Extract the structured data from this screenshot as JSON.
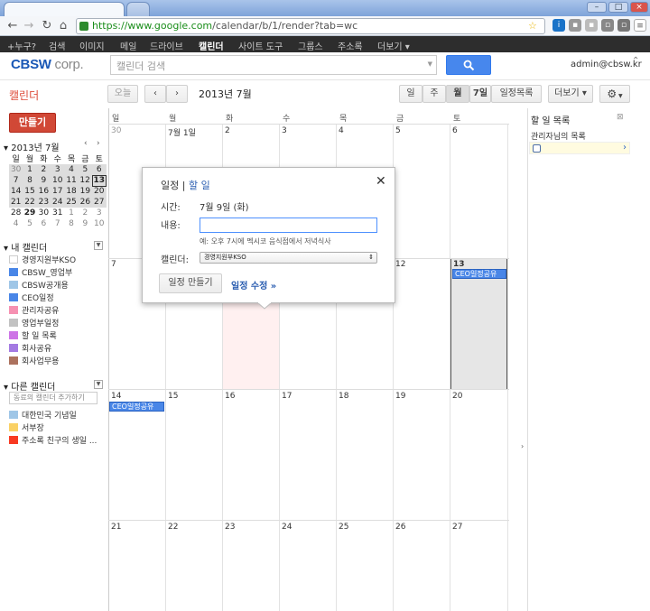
{
  "browser": {
    "url_host": "https://www.google.com",
    "url_path": "/calendar/b/1/render?tab=wc"
  },
  "gbar": {
    "items": [
      "+누구?",
      "검색",
      "이미지",
      "메일",
      "드라이브",
      "캘린더",
      "사이트 도구",
      "그룹스",
      "주소록",
      "더보기 ▾"
    ]
  },
  "header": {
    "logo": "CBSW corp.",
    "search_placeholder": "캘린더 검색",
    "user": "admin@cbsw.kr"
  },
  "toolbar": {
    "title": "캘린더",
    "today": "오늘",
    "date_range": "2013년 7월",
    "views": [
      "일",
      "주",
      "월",
      "7일",
      "일정목록"
    ],
    "more": "더보기 ▾"
  },
  "sidebar": {
    "create": "만들기",
    "mini_title": "2013년 7월",
    "mini_weekdays": [
      "일",
      "월",
      "화",
      "수",
      "목",
      "금",
      "토"
    ],
    "mini_weeks": [
      [
        "30",
        "1",
        "2",
        "3",
        "4",
        "5",
        "6"
      ],
      [
        "7",
        "8",
        "9",
        "10",
        "11",
        "12",
        "13"
      ],
      [
        "14",
        "15",
        "16",
        "17",
        "18",
        "19",
        "20"
      ],
      [
        "21",
        "22",
        "23",
        "24",
        "25",
        "26",
        "27"
      ],
      [
        "28",
        "29",
        "30",
        "31",
        "1",
        "2",
        "3"
      ],
      [
        "4",
        "5",
        "6",
        "7",
        "8",
        "9",
        "10"
      ]
    ],
    "my_cal_title": "내 캘린더",
    "my_cals": [
      {
        "name": "경영지원부KSO",
        "color": "#ffffff"
      },
      {
        "name": "CBSW_영업부",
        "color": "#4986e7"
      },
      {
        "name": "CBSW공개용",
        "color": "#9fc6e7"
      },
      {
        "name": "CEO일정",
        "color": "#4986e7"
      },
      {
        "name": "관리자공유",
        "color": "#f691b2"
      },
      {
        "name": "영업부일정",
        "color": "#c2c2c2"
      },
      {
        "name": "할 일 목록",
        "color": "#cd74e6"
      },
      {
        "name": "회사공유",
        "color": "#a47ae2"
      },
      {
        "name": "회사업무용",
        "color": "#ac725e"
      }
    ],
    "other_cal_title": "다른 캘린더",
    "add_placeholder": "동료의 캘린더 추가하기",
    "other_cals": [
      {
        "name": "대한민국 기념일",
        "color": "#9fc6e7"
      },
      {
        "name": "서부장",
        "color": "#fad165"
      },
      {
        "name": "주소록 친구의 생일 ...",
        "color": "#f83a22"
      }
    ]
  },
  "grid": {
    "weekdays": [
      "일",
      "월",
      "화",
      "수",
      "목",
      "금",
      "토"
    ],
    "weeks": [
      [
        "30",
        "7월 1일",
        "2",
        "3",
        "4",
        "5",
        "6"
      ],
      [
        "7",
        "8",
        "9",
        "10",
        "11",
        "12",
        "13"
      ],
      [
        "14",
        "15",
        "16",
        "17",
        "18",
        "19",
        "20"
      ],
      [
        "21",
        "22",
        "23",
        "24",
        "25",
        "26",
        "27"
      ]
    ],
    "event_label": "CEO일정공유"
  },
  "tasks": {
    "title": "할 일 목록",
    "list_name": "관리자님의 목록"
  },
  "popup": {
    "tab_event": "일정",
    "tab_sep": " | ",
    "tab_task": "할 일",
    "time_label": "시간:",
    "time_value": "7월 9일 (화)",
    "content_label": "내용:",
    "example": "예: 오후 7시에 멕시코 음식점에서 저녁식사",
    "calendar_label": "캘린더:",
    "calendar_value": "경영지원부KSO",
    "create_btn": "일정 만들기",
    "edit_link": "일정 수정 »"
  }
}
